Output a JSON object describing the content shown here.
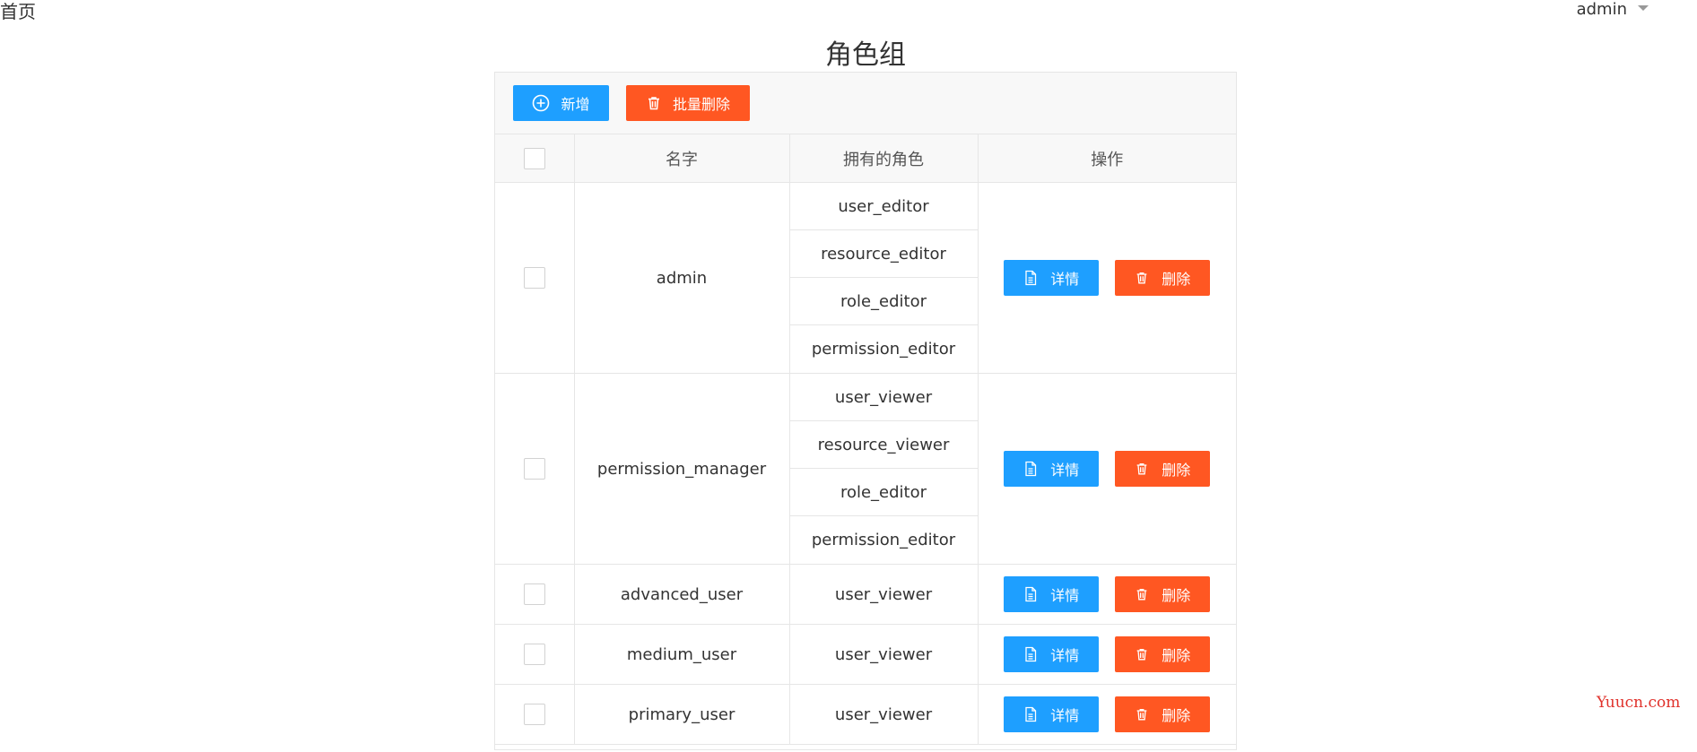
{
  "header": {
    "home_label": "首页",
    "user_label": "admin"
  },
  "page_title": "角色组",
  "toolbar": {
    "add_label": "新增",
    "batch_delete_label": "批量删除"
  },
  "table": {
    "columns": [
      "",
      "名字",
      "拥有的角色",
      "操作"
    ],
    "detail_label": "详情",
    "delete_label": "删除",
    "rows": [
      {
        "name": "admin",
        "roles": [
          "user_editor",
          "resource_editor",
          "role_editor",
          "permission_editor"
        ]
      },
      {
        "name": "permission_manager",
        "roles": [
          "user_viewer",
          "resource_viewer",
          "role_editor",
          "permission_editor"
        ]
      },
      {
        "name": "advanced_user",
        "roles": [
          "user_viewer"
        ]
      },
      {
        "name": "medium_user",
        "roles": [
          "user_viewer"
        ]
      },
      {
        "name": "primary_user",
        "roles": [
          "user_viewer"
        ]
      }
    ]
  },
  "watermark": "Yuucn.com",
  "colors": {
    "primary": "#1e9fff",
    "danger": "#ff5722",
    "header_bg": "#f8f8f8",
    "border": "#e6e6e6"
  },
  "icons": {
    "add": "plus-circle-icon",
    "delete": "trash-icon",
    "detail": "document-icon",
    "dropdown": "caret-down-icon"
  }
}
